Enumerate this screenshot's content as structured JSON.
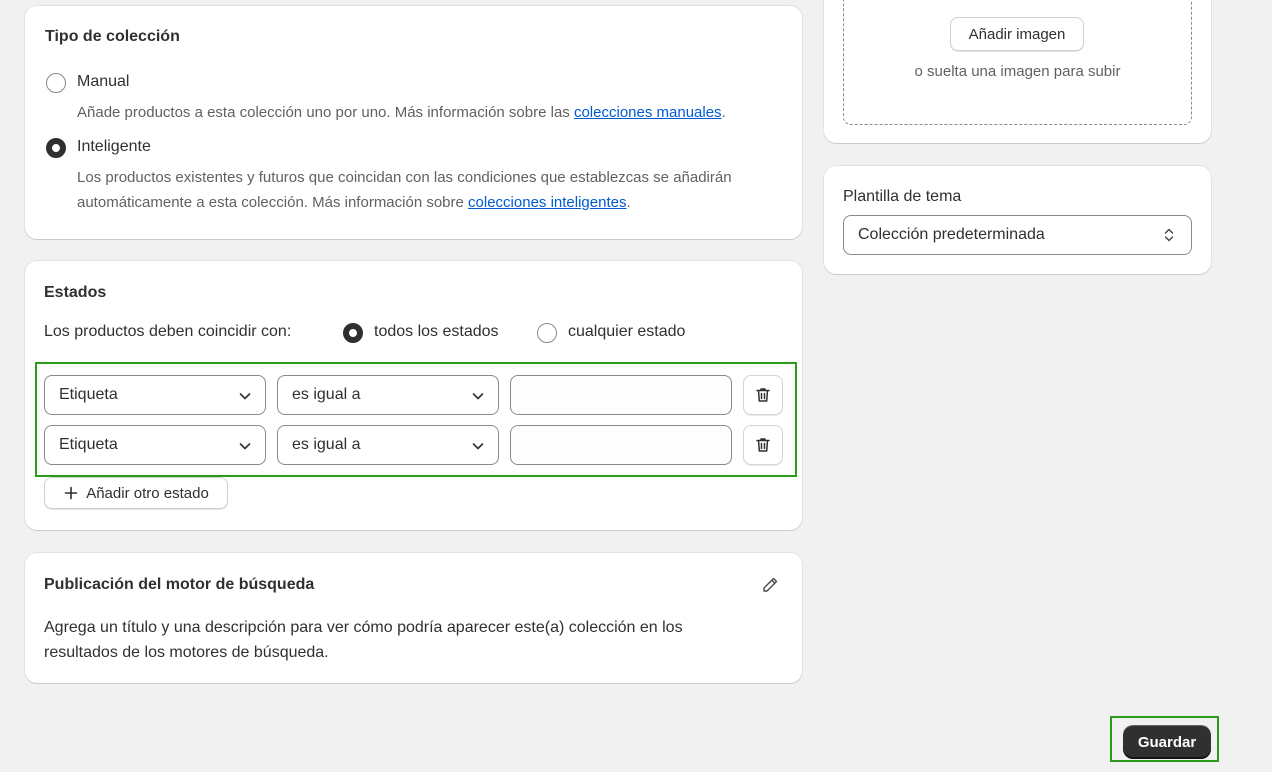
{
  "collection_type": {
    "title": "Tipo de colección",
    "manual_label": "Manual",
    "manual_help_prefix": "Añade productos a esta colección uno por uno. Más información sobre las ",
    "manual_help_link": "colecciones manuales",
    "manual_help_suffix": ".",
    "smart_label": "Inteligente",
    "smart_help_line1": "Los productos existentes y futuros que coincidan con las condiciones que establezcas se añadirán",
    "smart_help_line2_prefix": "automáticamente a esta colección. Más información sobre ",
    "smart_help_link": "colecciones inteligentes",
    "smart_help_suffix": ".",
    "selected": "Inteligente"
  },
  "conditions": {
    "title": "Estados",
    "match_label": "Los productos deben coincidir con:",
    "match_all_label": "todos los estados",
    "match_any_label": "cualquier estado",
    "match_selected": "todos los estados",
    "rows": [
      {
        "field": "Etiqueta",
        "operator": "es igual a",
        "value": ""
      },
      {
        "field": "Etiqueta",
        "operator": "es igual a",
        "value": ""
      }
    ],
    "add_label": "Añadir otro estado"
  },
  "seo": {
    "title": "Publicación del motor de búsqueda",
    "desc_line1": "Agrega un título y una descripción para ver cómo podría aparecer este(a) colección en los",
    "desc_line2": "resultados de los motores de búsqueda."
  },
  "image": {
    "add_button": "Añadir imagen",
    "drop_text": "o suelta una imagen para subir"
  },
  "theme_template": {
    "label": "Plantilla de tema",
    "selected": "Colección predeterminada"
  },
  "save_button": "Guardar",
  "colors": {
    "link": "#005bd3",
    "highlight": "#2e9a1d",
    "primary": "#303030"
  }
}
